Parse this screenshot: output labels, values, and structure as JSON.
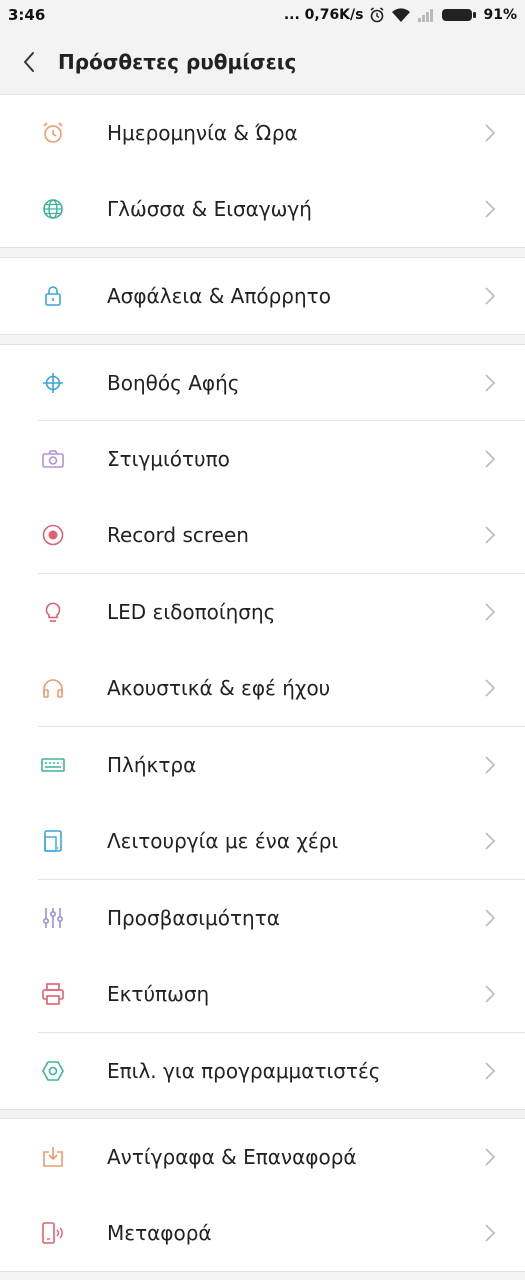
{
  "status_bar": {
    "time": "3:46",
    "speed": "... 0,76K/s",
    "battery": "91%"
  },
  "header": {
    "title": "Πρόσθετες ρυθμίσεις"
  },
  "items": [
    {
      "label": "Ημερομηνία & Ώρα",
      "icon": "alarm-clock-icon",
      "color": "#ef9a6a"
    },
    {
      "label": "Γλώσσα & Εισαγωγή",
      "icon": "globe-icon",
      "color": "#3fb39b"
    },
    {
      "label": "Ασφάλεια & Απόρρητο",
      "icon": "lock-icon",
      "color": "#3aa5d8"
    },
    {
      "label": "Βοηθός Αφής",
      "icon": "crosshair-icon",
      "color": "#3aa5d8"
    },
    {
      "label": "Στιγμιότυπο",
      "icon": "camera-icon",
      "color": "#b592d4"
    },
    {
      "label": "Record screen",
      "icon": "record-icon",
      "color": "#e06070"
    },
    {
      "label": "LED ειδοποίησης",
      "icon": "lightbulb-icon",
      "color": "#e06070"
    },
    {
      "label": "Ακουστικά & εφέ ήχου",
      "icon": "headphones-icon",
      "color": "#ef9a6a"
    },
    {
      "label": "Πλήκτρα",
      "icon": "keyboard-icon",
      "color": "#3fb39b"
    },
    {
      "label": "Λειτουργία με ένα χέρι",
      "icon": "one-hand-phone-icon",
      "color": "#3aa5d8"
    },
    {
      "label": "Προσβασιμότητα",
      "icon": "sliders-icon",
      "color": "#9c8fe0"
    },
    {
      "label": "Εκτύπωση",
      "icon": "printer-icon",
      "color": "#e06070"
    },
    {
      "label": "Επιλ. για προγραμματιστές",
      "icon": "hexagon-icon",
      "color": "#3fb39b"
    },
    {
      "label": "Αντίγραφα & Επαναφορά",
      "icon": "download-tray-icon",
      "color": "#ef9a6a"
    },
    {
      "label": "Μεταφορά",
      "icon": "phone-transfer-icon",
      "color": "#e06070"
    }
  ]
}
